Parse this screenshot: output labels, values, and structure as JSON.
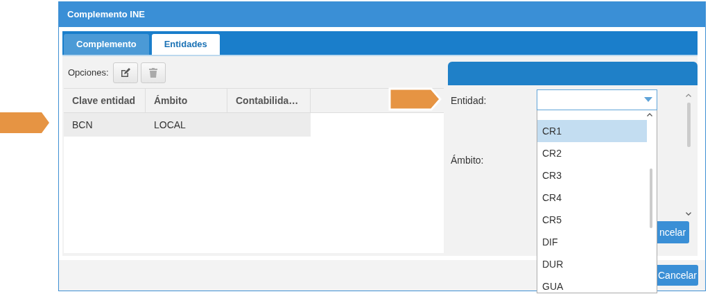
{
  "window": {
    "title": "Complemento INE"
  },
  "tabs": [
    {
      "label": "Complemento",
      "selected": false
    },
    {
      "label": "Entidades",
      "selected": true
    }
  ],
  "toolbar": {
    "label": "Opciones:"
  },
  "table": {
    "columns": [
      "Clave entidad",
      "Ámbito",
      "Contabilida…"
    ],
    "rows": [
      {
        "cells": [
          "BCN",
          "LOCAL"
        ],
        "selected": true
      }
    ]
  },
  "form": {
    "fields": [
      {
        "label": "Entidad:"
      },
      {
        "label": "Ámbito:"
      }
    ],
    "button": "ncelar"
  },
  "dropdown": {
    "options": [
      {
        "label": "CR1",
        "selected": true
      },
      {
        "label": "CR2",
        "selected": false
      },
      {
        "label": "CR3",
        "selected": false
      },
      {
        "label": "CR4",
        "selected": false
      },
      {
        "label": "CR5",
        "selected": false
      },
      {
        "label": "DIF",
        "selected": false
      },
      {
        "label": "DUR",
        "selected": false
      },
      {
        "label": "GUA",
        "selected": false
      }
    ]
  },
  "footer": {
    "button": "Cancelar"
  }
}
